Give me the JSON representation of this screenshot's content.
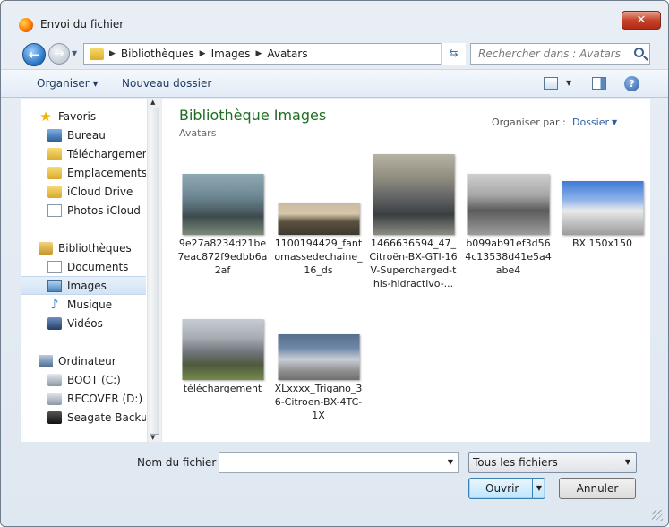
{
  "window": {
    "title": "Envoi du fichier",
    "close_label": "✕"
  },
  "address": {
    "crumbs": [
      "Bibliothèques",
      "Images",
      "Avatars"
    ],
    "search_placeholder": "Rechercher dans : Avatars"
  },
  "toolbar": {
    "organise_label": "Organiser ▾",
    "new_folder_label": "Nouveau dossier",
    "help_label": "?"
  },
  "sidebar": {
    "favorites": {
      "label": "Favoris",
      "items": [
        "Bureau",
        "Téléchargements",
        "Emplacements ré",
        "iCloud Drive",
        "Photos iCloud"
      ]
    },
    "libraries": {
      "label": "Bibliothèques",
      "items": [
        "Documents",
        "Images",
        "Musique",
        "Vidéos"
      ],
      "selected": "Images"
    },
    "computer": {
      "label": "Ordinateur",
      "items": [
        "BOOT (C:)",
        "RECOVER (D:)",
        "Seagate Backup F"
      ]
    }
  },
  "content": {
    "title": "Bibliothèque Images",
    "subtitle": "Avatars",
    "arrange_label": "Organiser par :",
    "arrange_value": "Dossier",
    "files": [
      {
        "name": "9e27a8234d21be7eac872f9edbb6a2af"
      },
      {
        "name": "1100194429_fantomassedechaine_16_ds"
      },
      {
        "name": "1466636594_47_Citroën-BX-GTI-16V-Supercharged-this-hidractivo-..."
      },
      {
        "name": "b099ab91ef3d564c13538d41e5a4abe4"
      },
      {
        "name": "BX 150x150"
      },
      {
        "name": "téléchargement"
      },
      {
        "name": "XLxxxx_Trigano_36-Citroen-BX-4TC-1X"
      }
    ]
  },
  "footer": {
    "filename_label": "Nom du fichier :",
    "filename_value": "",
    "filter_value": "Tous les fichiers",
    "open_label": "Ouvrir",
    "cancel_label": "Annuler"
  }
}
